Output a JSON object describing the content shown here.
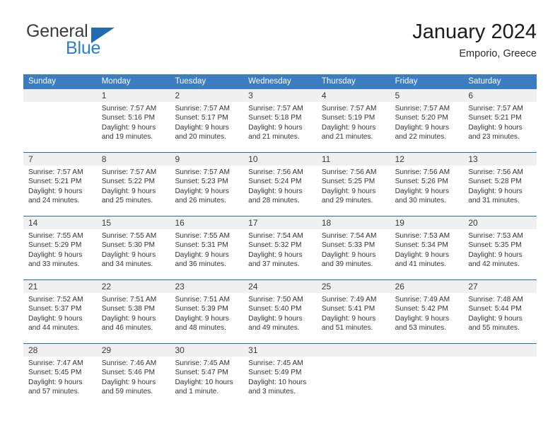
{
  "brand": {
    "name_top": "General",
    "name_bottom": "Blue",
    "accent_color": "#2a7fc9",
    "triangle_color": "#1f6cb0"
  },
  "header": {
    "title": "January 2024",
    "subtitle": "Emporio, Greece"
  },
  "calendar": {
    "header_bg": "#3b7dc0",
    "header_text_color": "#ffffff",
    "daynum_band_color": "#f0f0f0",
    "week_divider_color": "#2e6da8",
    "weekdays": [
      "Sunday",
      "Monday",
      "Tuesday",
      "Wednesday",
      "Thursday",
      "Friday",
      "Saturday"
    ],
    "weeks": [
      [
        {
          "day": "",
          "sunrise": "",
          "sunset": "",
          "daylight_line1": "",
          "daylight_line2": "",
          "empty": true
        },
        {
          "day": "1",
          "sunrise": "Sunrise: 7:57 AM",
          "sunset": "Sunset: 5:16 PM",
          "daylight_line1": "Daylight: 9 hours",
          "daylight_line2": "and 19 minutes."
        },
        {
          "day": "2",
          "sunrise": "Sunrise: 7:57 AM",
          "sunset": "Sunset: 5:17 PM",
          "daylight_line1": "Daylight: 9 hours",
          "daylight_line2": "and 20 minutes."
        },
        {
          "day": "3",
          "sunrise": "Sunrise: 7:57 AM",
          "sunset": "Sunset: 5:18 PM",
          "daylight_line1": "Daylight: 9 hours",
          "daylight_line2": "and 21 minutes."
        },
        {
          "day": "4",
          "sunrise": "Sunrise: 7:57 AM",
          "sunset": "Sunset: 5:19 PM",
          "daylight_line1": "Daylight: 9 hours",
          "daylight_line2": "and 21 minutes."
        },
        {
          "day": "5",
          "sunrise": "Sunrise: 7:57 AM",
          "sunset": "Sunset: 5:20 PM",
          "daylight_line1": "Daylight: 9 hours",
          "daylight_line2": "and 22 minutes."
        },
        {
          "day": "6",
          "sunrise": "Sunrise: 7:57 AM",
          "sunset": "Sunset: 5:21 PM",
          "daylight_line1": "Daylight: 9 hours",
          "daylight_line2": "and 23 minutes."
        }
      ],
      [
        {
          "day": "7",
          "sunrise": "Sunrise: 7:57 AM",
          "sunset": "Sunset: 5:21 PM",
          "daylight_line1": "Daylight: 9 hours",
          "daylight_line2": "and 24 minutes."
        },
        {
          "day": "8",
          "sunrise": "Sunrise: 7:57 AM",
          "sunset": "Sunset: 5:22 PM",
          "daylight_line1": "Daylight: 9 hours",
          "daylight_line2": "and 25 minutes."
        },
        {
          "day": "9",
          "sunrise": "Sunrise: 7:57 AM",
          "sunset": "Sunset: 5:23 PM",
          "daylight_line1": "Daylight: 9 hours",
          "daylight_line2": "and 26 minutes."
        },
        {
          "day": "10",
          "sunrise": "Sunrise: 7:56 AM",
          "sunset": "Sunset: 5:24 PM",
          "daylight_line1": "Daylight: 9 hours",
          "daylight_line2": "and 28 minutes."
        },
        {
          "day": "11",
          "sunrise": "Sunrise: 7:56 AM",
          "sunset": "Sunset: 5:25 PM",
          "daylight_line1": "Daylight: 9 hours",
          "daylight_line2": "and 29 minutes."
        },
        {
          "day": "12",
          "sunrise": "Sunrise: 7:56 AM",
          "sunset": "Sunset: 5:26 PM",
          "daylight_line1": "Daylight: 9 hours",
          "daylight_line2": "and 30 minutes."
        },
        {
          "day": "13",
          "sunrise": "Sunrise: 7:56 AM",
          "sunset": "Sunset: 5:28 PM",
          "daylight_line1": "Daylight: 9 hours",
          "daylight_line2": "and 31 minutes."
        }
      ],
      [
        {
          "day": "14",
          "sunrise": "Sunrise: 7:55 AM",
          "sunset": "Sunset: 5:29 PM",
          "daylight_line1": "Daylight: 9 hours",
          "daylight_line2": "and 33 minutes."
        },
        {
          "day": "15",
          "sunrise": "Sunrise: 7:55 AM",
          "sunset": "Sunset: 5:30 PM",
          "daylight_line1": "Daylight: 9 hours",
          "daylight_line2": "and 34 minutes."
        },
        {
          "day": "16",
          "sunrise": "Sunrise: 7:55 AM",
          "sunset": "Sunset: 5:31 PM",
          "daylight_line1": "Daylight: 9 hours",
          "daylight_line2": "and 36 minutes."
        },
        {
          "day": "17",
          "sunrise": "Sunrise: 7:54 AM",
          "sunset": "Sunset: 5:32 PM",
          "daylight_line1": "Daylight: 9 hours",
          "daylight_line2": "and 37 minutes."
        },
        {
          "day": "18",
          "sunrise": "Sunrise: 7:54 AM",
          "sunset": "Sunset: 5:33 PM",
          "daylight_line1": "Daylight: 9 hours",
          "daylight_line2": "and 39 minutes."
        },
        {
          "day": "19",
          "sunrise": "Sunrise: 7:53 AM",
          "sunset": "Sunset: 5:34 PM",
          "daylight_line1": "Daylight: 9 hours",
          "daylight_line2": "and 41 minutes."
        },
        {
          "day": "20",
          "sunrise": "Sunrise: 7:53 AM",
          "sunset": "Sunset: 5:35 PM",
          "daylight_line1": "Daylight: 9 hours",
          "daylight_line2": "and 42 minutes."
        }
      ],
      [
        {
          "day": "21",
          "sunrise": "Sunrise: 7:52 AM",
          "sunset": "Sunset: 5:37 PM",
          "daylight_line1": "Daylight: 9 hours",
          "daylight_line2": "and 44 minutes."
        },
        {
          "day": "22",
          "sunrise": "Sunrise: 7:51 AM",
          "sunset": "Sunset: 5:38 PM",
          "daylight_line1": "Daylight: 9 hours",
          "daylight_line2": "and 46 minutes."
        },
        {
          "day": "23",
          "sunrise": "Sunrise: 7:51 AM",
          "sunset": "Sunset: 5:39 PM",
          "daylight_line1": "Daylight: 9 hours",
          "daylight_line2": "and 48 minutes."
        },
        {
          "day": "24",
          "sunrise": "Sunrise: 7:50 AM",
          "sunset": "Sunset: 5:40 PM",
          "daylight_line1": "Daylight: 9 hours",
          "daylight_line2": "and 49 minutes."
        },
        {
          "day": "25",
          "sunrise": "Sunrise: 7:49 AM",
          "sunset": "Sunset: 5:41 PM",
          "daylight_line1": "Daylight: 9 hours",
          "daylight_line2": "and 51 minutes."
        },
        {
          "day": "26",
          "sunrise": "Sunrise: 7:49 AM",
          "sunset": "Sunset: 5:42 PM",
          "daylight_line1": "Daylight: 9 hours",
          "daylight_line2": "and 53 minutes."
        },
        {
          "day": "27",
          "sunrise": "Sunrise: 7:48 AM",
          "sunset": "Sunset: 5:44 PM",
          "daylight_line1": "Daylight: 9 hours",
          "daylight_line2": "and 55 minutes."
        }
      ],
      [
        {
          "day": "28",
          "sunrise": "Sunrise: 7:47 AM",
          "sunset": "Sunset: 5:45 PM",
          "daylight_line1": "Daylight: 9 hours",
          "daylight_line2": "and 57 minutes."
        },
        {
          "day": "29",
          "sunrise": "Sunrise: 7:46 AM",
          "sunset": "Sunset: 5:46 PM",
          "daylight_line1": "Daylight: 9 hours",
          "daylight_line2": "and 59 minutes."
        },
        {
          "day": "30",
          "sunrise": "Sunrise: 7:45 AM",
          "sunset": "Sunset: 5:47 PM",
          "daylight_line1": "Daylight: 10 hours",
          "daylight_line2": "and 1 minute."
        },
        {
          "day": "31",
          "sunrise": "Sunrise: 7:45 AM",
          "sunset": "Sunset: 5:49 PM",
          "daylight_line1": "Daylight: 10 hours",
          "daylight_line2": "and 3 minutes."
        },
        {
          "day": "",
          "sunrise": "",
          "sunset": "",
          "daylight_line1": "",
          "daylight_line2": "",
          "empty": true
        },
        {
          "day": "",
          "sunrise": "",
          "sunset": "",
          "daylight_line1": "",
          "daylight_line2": "",
          "empty": true
        },
        {
          "day": "",
          "sunrise": "",
          "sunset": "",
          "daylight_line1": "",
          "daylight_line2": "",
          "empty": true
        }
      ]
    ]
  }
}
